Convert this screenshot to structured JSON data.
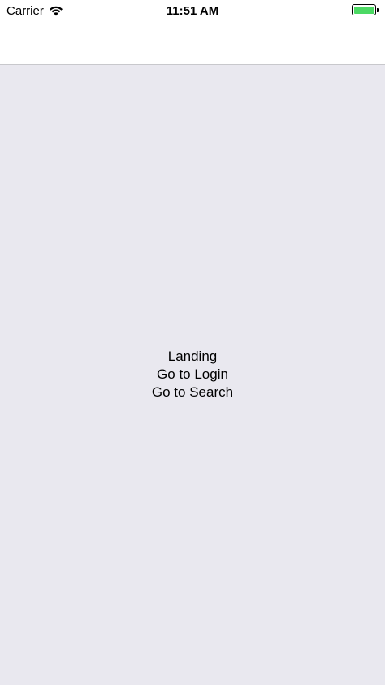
{
  "status_bar": {
    "carrier": "Carrier",
    "time": "11:51 AM",
    "wifi_icon": "wifi-icon",
    "battery_icon": "battery-icon",
    "battery_color": "#4cd964",
    "battery_level": 1.0
  },
  "main": {
    "title": "Landing",
    "login_link": "Go to Login",
    "search_link": "Go to Search",
    "background": "#e9e8ef"
  }
}
